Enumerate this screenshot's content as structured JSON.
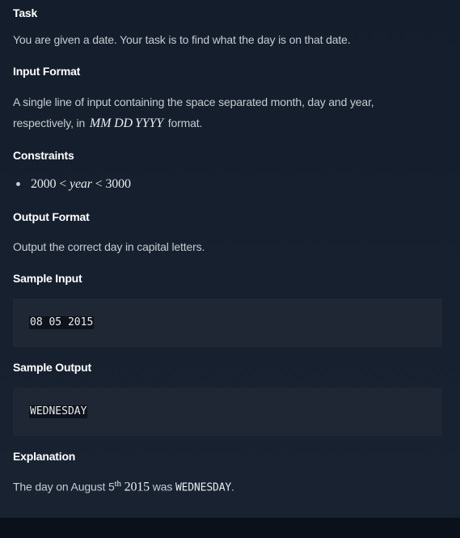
{
  "task": {
    "heading": "Task",
    "text": "You are given a date. Your task is to find what the day is on that date."
  },
  "input_format": {
    "heading": "Input Format",
    "line1": "A single line of input containing the space separated month, day and year,",
    "line2_prefix": "respectively, in",
    "math_mm": "MM",
    "math_dd": "DD",
    "math_yyyy": "YYYY",
    "line2_suffix": "format."
  },
  "constraints": {
    "heading": "Constraints",
    "low": "2000",
    "op1": "<",
    "var": "year",
    "op2": "<",
    "high": "3000"
  },
  "output_format": {
    "heading": "Output Format",
    "text": "Output the correct day in capital letters."
  },
  "sample_input": {
    "heading": "Sample Input",
    "code": "08 05 2015"
  },
  "sample_output": {
    "heading": "Sample Output",
    "code": "WEDNESDAY"
  },
  "explanation": {
    "heading": "Explanation",
    "prefix": "The day on August 5",
    "sup": "th",
    "year": "2015",
    "was": "was",
    "code": "WEDNESDAY",
    "period": "."
  }
}
